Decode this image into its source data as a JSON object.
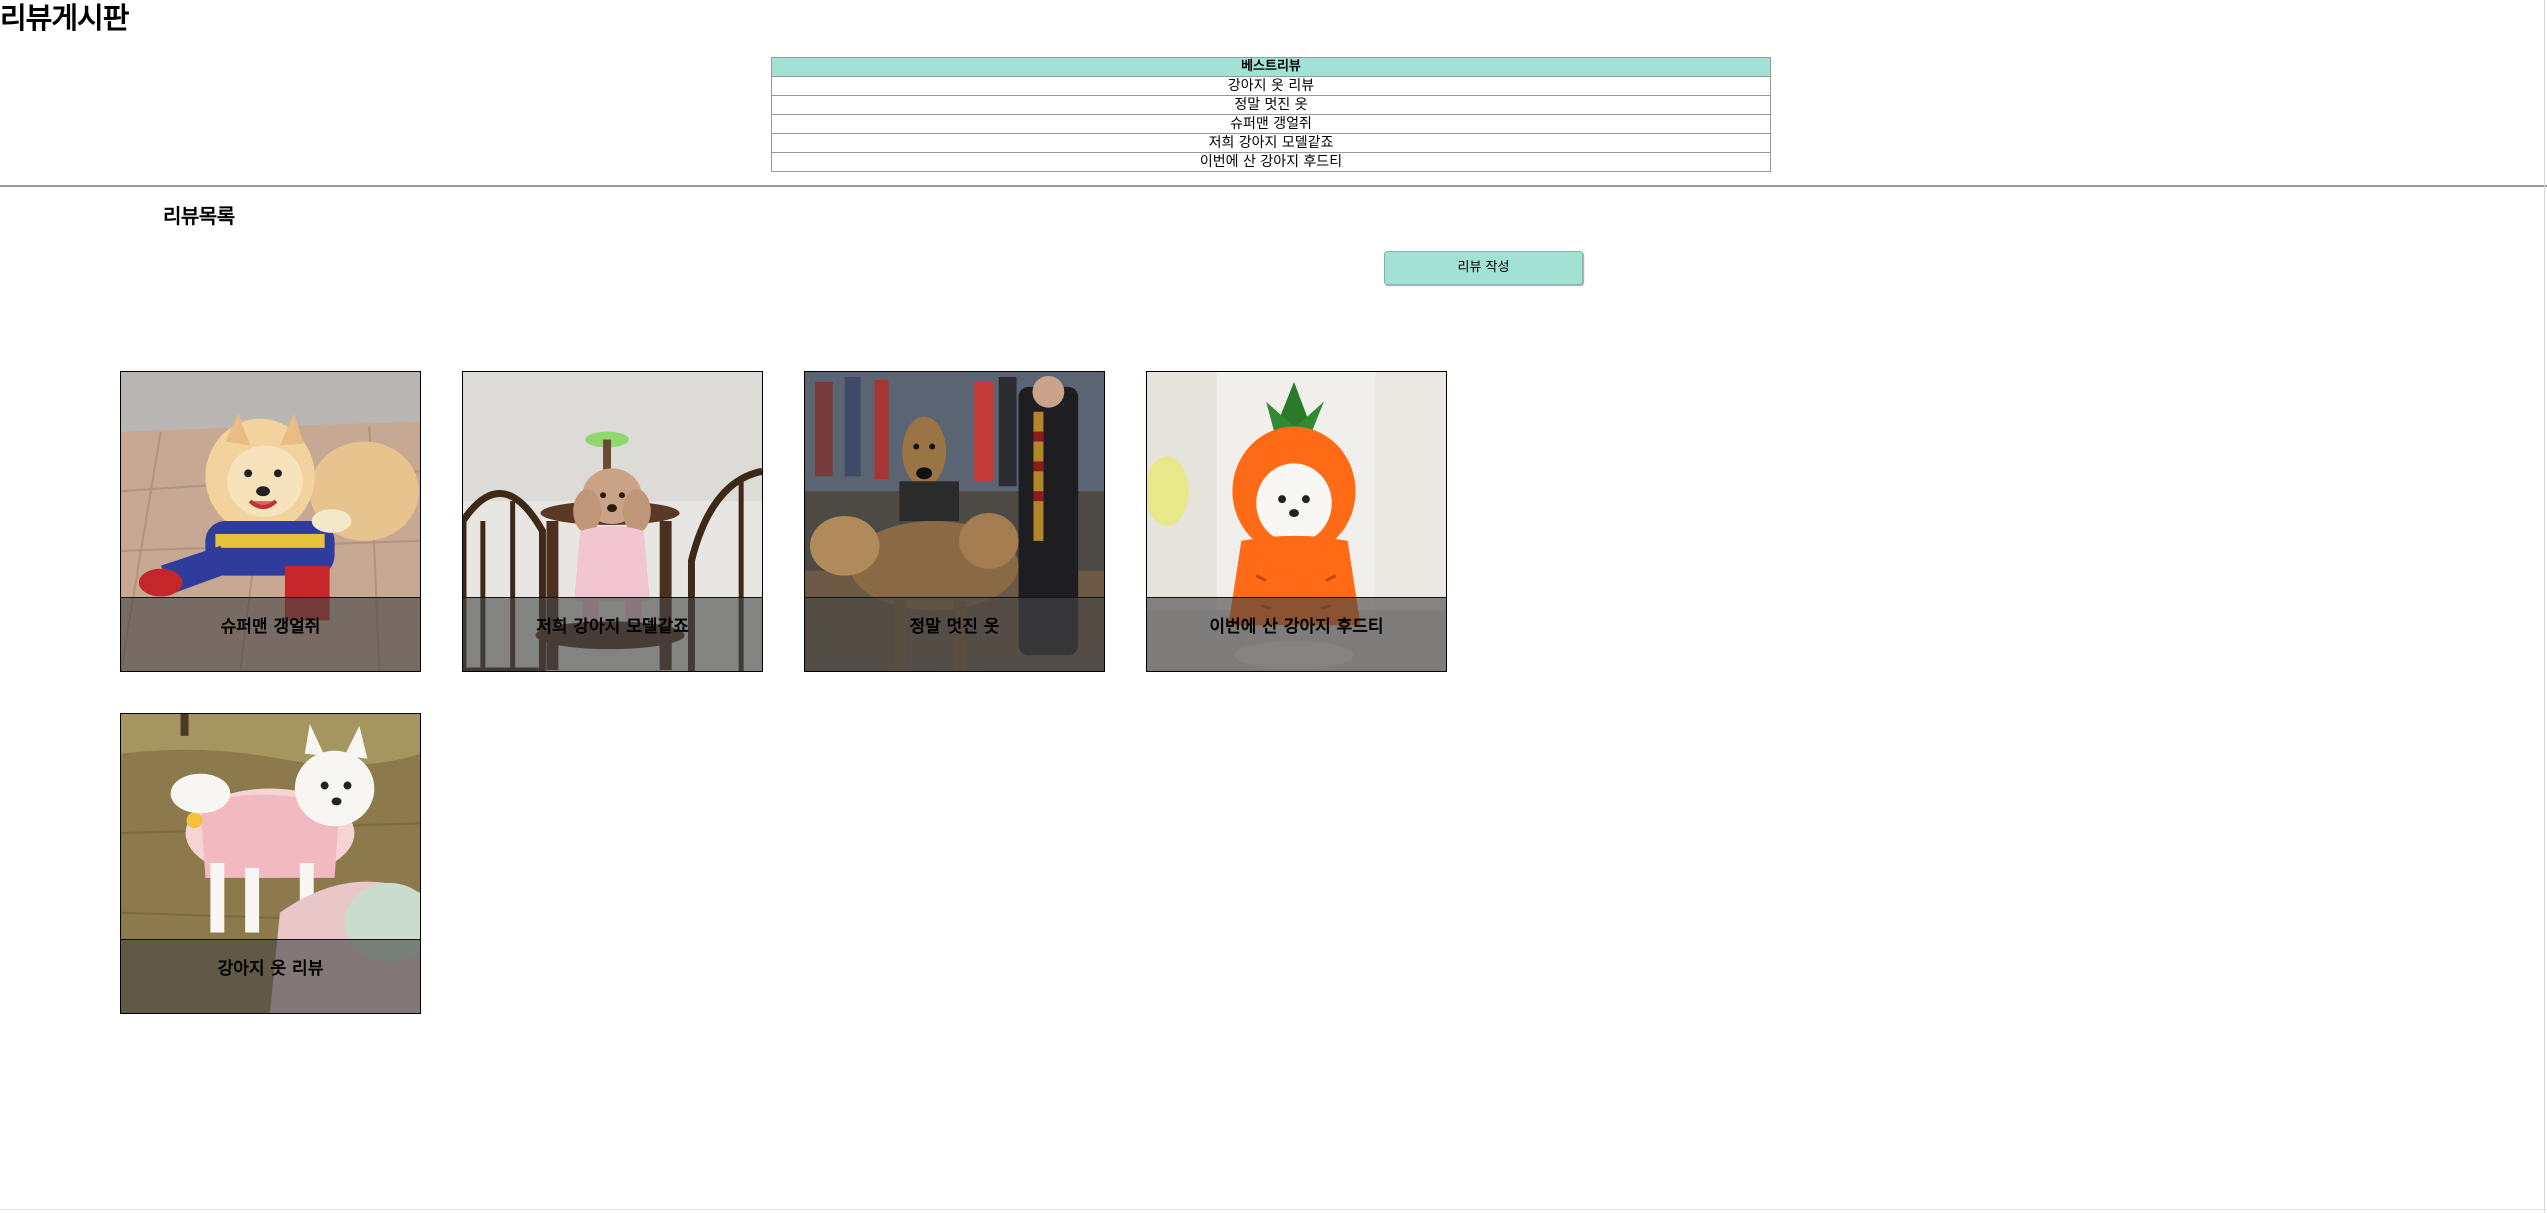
{
  "header": {
    "title": "리뷰게시판"
  },
  "best_reviews": {
    "heading": "베스트리뷰",
    "items": [
      "강아지 옷 리뷰",
      "정말 멋진 옷",
      "슈퍼맨 갱얼쥐",
      "저희 강아지 모델같죠",
      "이번에 산 강아지 후드티"
    ]
  },
  "review_list": {
    "title": "리뷰목록",
    "write_button": "리뷰 작성",
    "cards": [
      {
        "caption": "슈퍼맨 갱얼쥐",
        "image": "pomeranian-superman-costume"
      },
      {
        "caption": "저희 강아지 모델같죠",
        "image": "poodle-pink-sweater-on-stool"
      },
      {
        "caption": "정말 멋진 옷",
        "image": "dogs-three-headed-costume"
      },
      {
        "caption": "이번에 산 강아지 후드티",
        "image": "dog-carrot-hoodie"
      },
      {
        "caption": "강아지 옷 리뷰",
        "image": "white-dog-pink-shirt-on-grass"
      }
    ]
  },
  "colors": {
    "accent": "#a3e1d4",
    "caption_overlay": "#464646",
    "divider": "#9a9a9a"
  }
}
